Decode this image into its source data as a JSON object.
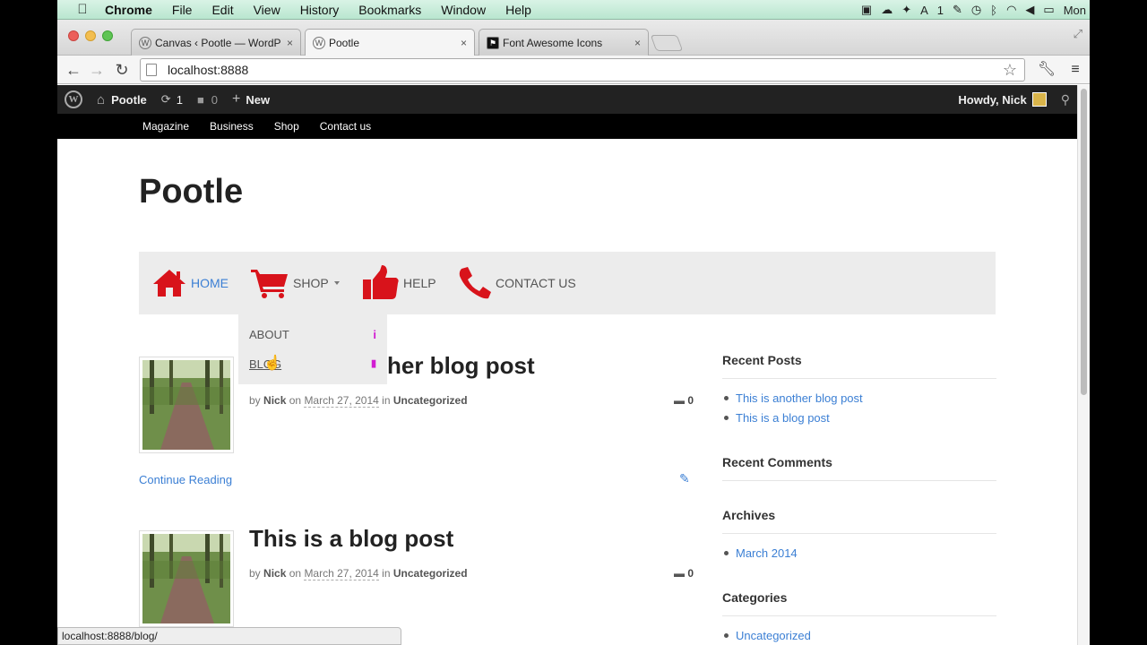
{
  "menubar": {
    "app": "Chrome",
    "items": [
      "File",
      "Edit",
      "View",
      "History",
      "Bookmarks",
      "Window",
      "Help"
    ],
    "right_text": "Mon",
    "badge": "1"
  },
  "tabs": [
    {
      "label": "Canvas ‹ Pootle — WordPr",
      "close": "×"
    },
    {
      "label": "Pootle",
      "close": "×"
    },
    {
      "label": "Font Awesome Icons",
      "close": "×"
    }
  ],
  "address": {
    "url": "localhost:8888"
  },
  "adminbar": {
    "site": "Pootle",
    "updates": "1",
    "comments": "0",
    "new": "New",
    "howdy": "Howdy, Nick"
  },
  "topnav": [
    "Magazine",
    "Business",
    "Shop",
    "Contact us"
  ],
  "site": {
    "title": "Pootle"
  },
  "mainnav": {
    "home": "HOME",
    "shop": "SHOP",
    "help": "HELP",
    "contact": "CONTACT US",
    "dropdown": [
      {
        "label": "ABOUT",
        "icon": "info-icon",
        "glyph": "i"
      },
      {
        "label": "BLOG",
        "icon": "file-icon",
        "glyph": "▮"
      }
    ]
  },
  "posts": [
    {
      "title_visible": "her blog post",
      "by": "by",
      "author": "Nick",
      "on": "on",
      "date": "March 27, 2014",
      "in": "in",
      "category": "Uncategorized",
      "comments": "0",
      "continue": "Continue Reading"
    },
    {
      "title_visible": "This is a blog post",
      "by": "by",
      "author": "Nick",
      "on": "on",
      "date": "March 27, 2014",
      "in": "in",
      "category": "Uncategorized",
      "comments": "0"
    }
  ],
  "sidebar": {
    "recent_posts_title": "Recent Posts",
    "recent_posts": [
      "This is another blog post",
      "This is a blog post"
    ],
    "recent_comments_title": "Recent Comments",
    "archives_title": "Archives",
    "archives": [
      "March 2014"
    ],
    "categories_title": "Categories",
    "categories": [
      "Uncategorized"
    ]
  },
  "statusbar": {
    "url": "localhost:8888/blog/"
  },
  "colors": {
    "accent": "#3b7fd4",
    "icon_red": "#d8131b",
    "dropdown_icon": "#d21dd2",
    "adminbar": "#222222"
  }
}
